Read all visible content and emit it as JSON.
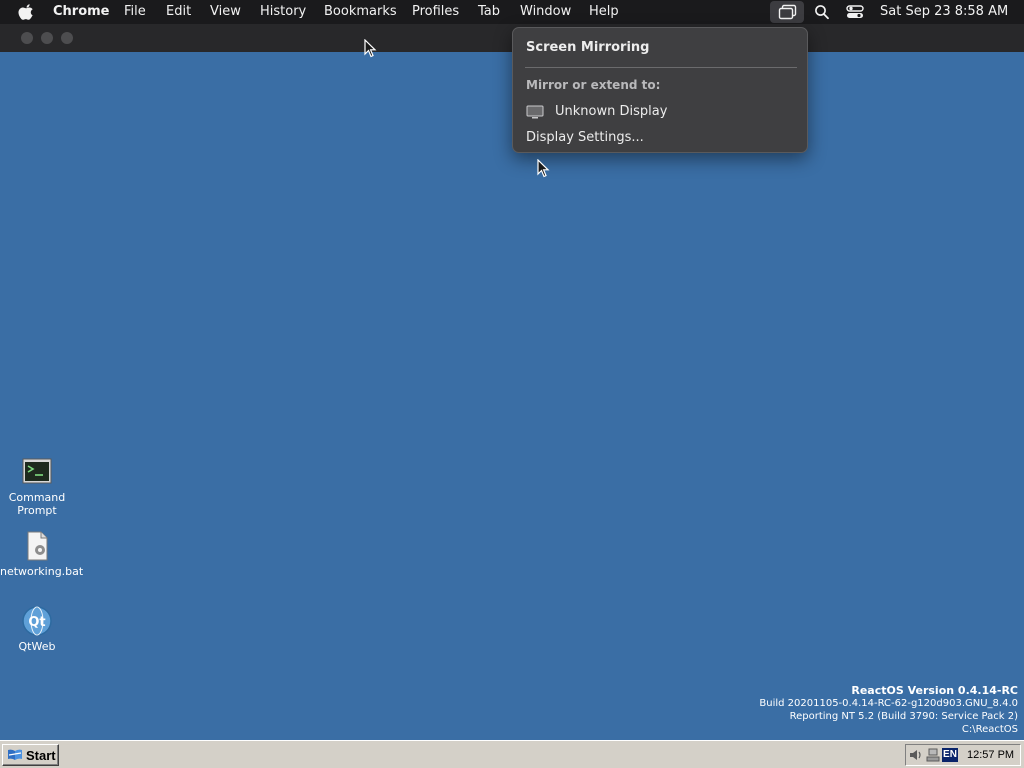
{
  "menubar": {
    "app_name": "Chrome",
    "menus": [
      "File",
      "Edit",
      "View",
      "History",
      "Bookmarks",
      "Profiles",
      "Tab",
      "Window",
      "Help"
    ],
    "status_icons": [
      "screen-mirroring-icon",
      "spotlight-search-icon",
      "control-center-icon"
    ],
    "datetime": "Sat Sep 23  8:58 AM"
  },
  "mirror_menu": {
    "title": "Screen Mirroring",
    "section_label": "Mirror or extend to:",
    "display_name": "Unknown Display",
    "settings_label": "Display Settings..."
  },
  "desktop_icons": [
    {
      "label": "Command Prompt",
      "icon": "command-prompt-icon"
    },
    {
      "label": "networking.bat",
      "icon": "batch-file-icon"
    },
    {
      "label": "QtWeb",
      "icon": "qtweb-icon"
    }
  ],
  "version_info": {
    "title": "ReactOS Version 0.4.14-RC",
    "build": "Build 20201105-0.4.14-RC-62-g120d903.GNU_8.4.0",
    "reporting": "Reporting NT 5.2 (Build 3790: Service Pack 2)",
    "path": "C:\\ReactOS"
  },
  "taskbar": {
    "start_label": "Start",
    "language": "EN",
    "clock": "12:57 PM"
  },
  "colors": {
    "desktop": "#3a6ea5",
    "menubar": "#1a1a1c",
    "menu_panel": "#3f3f41",
    "taskbar": "#d4d0c8"
  }
}
